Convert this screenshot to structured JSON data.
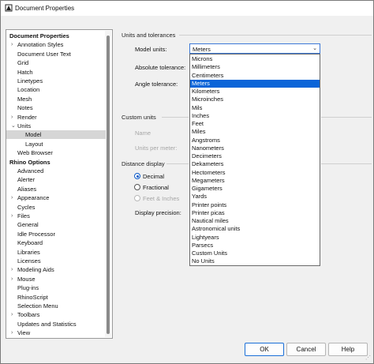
{
  "window": {
    "title": "Document Properties"
  },
  "tree": {
    "items": [
      {
        "label": "Document Properties",
        "bold": true,
        "indent": 0,
        "chevron": ""
      },
      {
        "label": "Annotation Styles",
        "bold": false,
        "indent": 1,
        "chevron": "›"
      },
      {
        "label": "Document User Text",
        "bold": false,
        "indent": 1,
        "chevron": ""
      },
      {
        "label": "Grid",
        "bold": false,
        "indent": 1,
        "chevron": ""
      },
      {
        "label": "Hatch",
        "bold": false,
        "indent": 1,
        "chevron": ""
      },
      {
        "label": "Linetypes",
        "bold": false,
        "indent": 1,
        "chevron": ""
      },
      {
        "label": "Location",
        "bold": false,
        "indent": 1,
        "chevron": ""
      },
      {
        "label": "Mesh",
        "bold": false,
        "indent": 1,
        "chevron": ""
      },
      {
        "label": "Notes",
        "bold": false,
        "indent": 1,
        "chevron": ""
      },
      {
        "label": "Render",
        "bold": false,
        "indent": 1,
        "chevron": "›"
      },
      {
        "label": "Units",
        "bold": false,
        "indent": 1,
        "chevron": "⌄"
      },
      {
        "label": "Model",
        "bold": false,
        "indent": 2,
        "chevron": "",
        "selected": true
      },
      {
        "label": "Layout",
        "bold": false,
        "indent": 2,
        "chevron": ""
      },
      {
        "label": "Web Browser",
        "bold": false,
        "indent": 1,
        "chevron": ""
      },
      {
        "label": "Rhino Options",
        "bold": true,
        "indent": 0,
        "chevron": ""
      },
      {
        "label": "Advanced",
        "bold": false,
        "indent": 1,
        "chevron": ""
      },
      {
        "label": "Alerter",
        "bold": false,
        "indent": 1,
        "chevron": ""
      },
      {
        "label": "Aliases",
        "bold": false,
        "indent": 1,
        "chevron": ""
      },
      {
        "label": "Appearance",
        "bold": false,
        "indent": 1,
        "chevron": "›"
      },
      {
        "label": "Cycles",
        "bold": false,
        "indent": 1,
        "chevron": ""
      },
      {
        "label": "Files",
        "bold": false,
        "indent": 1,
        "chevron": "›"
      },
      {
        "label": "General",
        "bold": false,
        "indent": 1,
        "chevron": ""
      },
      {
        "label": "Idle Processor",
        "bold": false,
        "indent": 1,
        "chevron": ""
      },
      {
        "label": "Keyboard",
        "bold": false,
        "indent": 1,
        "chevron": ""
      },
      {
        "label": "Libraries",
        "bold": false,
        "indent": 1,
        "chevron": ""
      },
      {
        "label": "Licenses",
        "bold": false,
        "indent": 1,
        "chevron": ""
      },
      {
        "label": "Modeling Aids",
        "bold": false,
        "indent": 1,
        "chevron": "›"
      },
      {
        "label": "Mouse",
        "bold": false,
        "indent": 1,
        "chevron": "›"
      },
      {
        "label": "Plug-ins",
        "bold": false,
        "indent": 1,
        "chevron": ""
      },
      {
        "label": "RhinoScript",
        "bold": false,
        "indent": 1,
        "chevron": ""
      },
      {
        "label": "Selection Menu",
        "bold": false,
        "indent": 1,
        "chevron": ""
      },
      {
        "label": "Toolbars",
        "bold": false,
        "indent": 1,
        "chevron": "›"
      },
      {
        "label": "Updates and Statistics",
        "bold": false,
        "indent": 1,
        "chevron": ""
      },
      {
        "label": "View",
        "bold": false,
        "indent": 1,
        "chevron": "›"
      }
    ]
  },
  "units": {
    "group_label": "Units and tolerances",
    "model_units_label": "Model units:",
    "model_units_value": "Meters",
    "absolute_tolerance_label": "Absolute tolerance:",
    "angle_tolerance_label": "Angle tolerance:"
  },
  "custom_units": {
    "group_label": "Custom units",
    "name_label": "Name",
    "units_per_meter_label": "Units per meter:"
  },
  "distance_display": {
    "group_label": "Distance display",
    "decimal_label": "Decimal",
    "fractional_label": "Fractional",
    "feet_inches_label": "Feet & Inches",
    "display_precision_label": "Display precision:",
    "selected": "Decimal"
  },
  "dropdown": {
    "options": [
      "Microns",
      "Millimeters",
      "Centimeters",
      "Meters",
      "Kilometers",
      "Microinches",
      "Mils",
      "Inches",
      "Feet",
      "Miles",
      "Angstroms",
      "Nanometers",
      "Decimeters",
      "Dekameters",
      "Hectometers",
      "Megameters",
      "Gigameters",
      "Yards",
      "Printer points",
      "Printer picas",
      "Nautical miles",
      "Astronomical units",
      "Lightyears",
      "Parsecs",
      "Custom Units",
      "No Units"
    ],
    "highlighted": "Meters"
  },
  "buttons": {
    "ok": "OK",
    "cancel": "Cancel",
    "help": "Help"
  },
  "colors": {
    "highlight": "#0a64d8",
    "focus_border": "#3c78d8"
  }
}
